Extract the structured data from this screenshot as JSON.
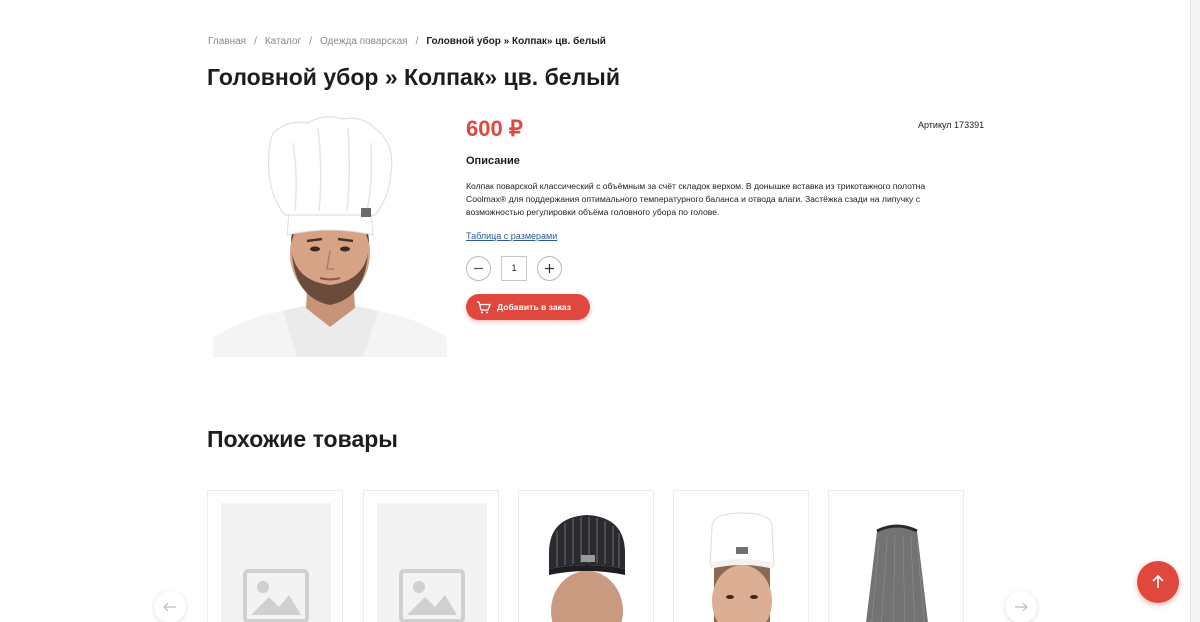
{
  "breadcrumb": {
    "items": [
      "Главная",
      "Каталог",
      "Одежда поварская"
    ],
    "current": "Головной убор » Колпак» цв. белый",
    "separator": "/"
  },
  "product": {
    "title": "Головной убор » Колпак» цв. белый",
    "price": "600 ₽",
    "sku": "Артикул 173391",
    "description_title": "Описание",
    "description": "Колпак поварской классический с объёмным за счёт складок верхом. В донышке вставка из трикотажного полотна Coolmax® для поддержания оптимального температурного баланса и отвода влаги. Застёжка сзади на липучку с возможностью регулировки объёма головного убора по голове.",
    "size_table_link": "Таблица с размерами",
    "quantity": "1",
    "add_to_order_label": "Добавить в заказ"
  },
  "similar": {
    "title": "Похожие товары",
    "cards": [
      {
        "kind": "placeholder"
      },
      {
        "kind": "placeholder"
      },
      {
        "kind": "striped-cap"
      },
      {
        "kind": "white-cap-woman"
      },
      {
        "kind": "hairnet"
      }
    ]
  },
  "icons": {
    "minus": "minus-icon",
    "plus": "plus-icon",
    "cart": "cart-icon",
    "prev": "arrow-left-icon",
    "next": "arrow-right-icon",
    "to_top": "arrow-up-icon"
  },
  "colors": {
    "accent": "#e0483d",
    "link": "#2c5aa0",
    "text": "#1d1d1d",
    "muted": "#8a8a8a"
  }
}
